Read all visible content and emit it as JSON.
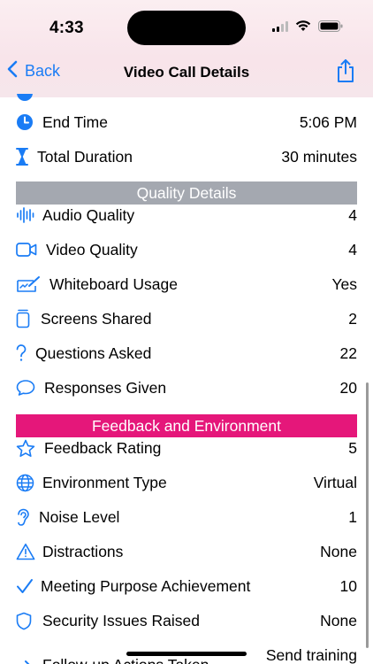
{
  "status_bar": {
    "time": "4:33"
  },
  "nav": {
    "back_label": "Back",
    "title": "Video Call Details"
  },
  "colors": {
    "accent": "#1a7cf5",
    "quality_header": "#a4a8b0",
    "feedback_header": "#e5177a"
  },
  "rows_top": [
    {
      "icon": "clock-icon",
      "label": "End Time",
      "value": "5:06 PM"
    },
    {
      "icon": "hourglass-icon",
      "label": "Total Duration",
      "value": "30 minutes"
    }
  ],
  "sections": {
    "quality": "Quality Details",
    "feedback": "Feedback and Environment"
  },
  "quality_rows": [
    {
      "icon": "waveform-icon",
      "label": "Audio Quality",
      "value": "4"
    },
    {
      "icon": "video-icon",
      "label": "Video Quality",
      "value": "4"
    },
    {
      "icon": "whiteboard-icon",
      "label": "Whiteboard Usage",
      "value": "Yes"
    },
    {
      "icon": "screens-icon",
      "label": "Screens Shared",
      "value": "2"
    },
    {
      "icon": "question-icon",
      "label": "Questions Asked",
      "value": "22"
    },
    {
      "icon": "speech-bubble-icon",
      "label": "Responses Given",
      "value": "20"
    }
  ],
  "feedback_rows": [
    {
      "icon": "star-icon",
      "label": "Feedback Rating",
      "value": "5"
    },
    {
      "icon": "globe-icon",
      "label": "Environment Type",
      "value": "Virtual"
    },
    {
      "icon": "ear-icon",
      "label": "Noise Level",
      "value": "1"
    },
    {
      "icon": "warning-icon",
      "label": "Distractions",
      "value": "None"
    },
    {
      "icon": "checkmark-icon",
      "label": "Meeting Purpose Achievement",
      "value": "10"
    },
    {
      "icon": "shield-icon",
      "label": "Security Issues Raised",
      "value": "None"
    },
    {
      "icon": "arrow-icon",
      "label": "Follow-up Actions Taken",
      "value": "Send training"
    }
  ]
}
